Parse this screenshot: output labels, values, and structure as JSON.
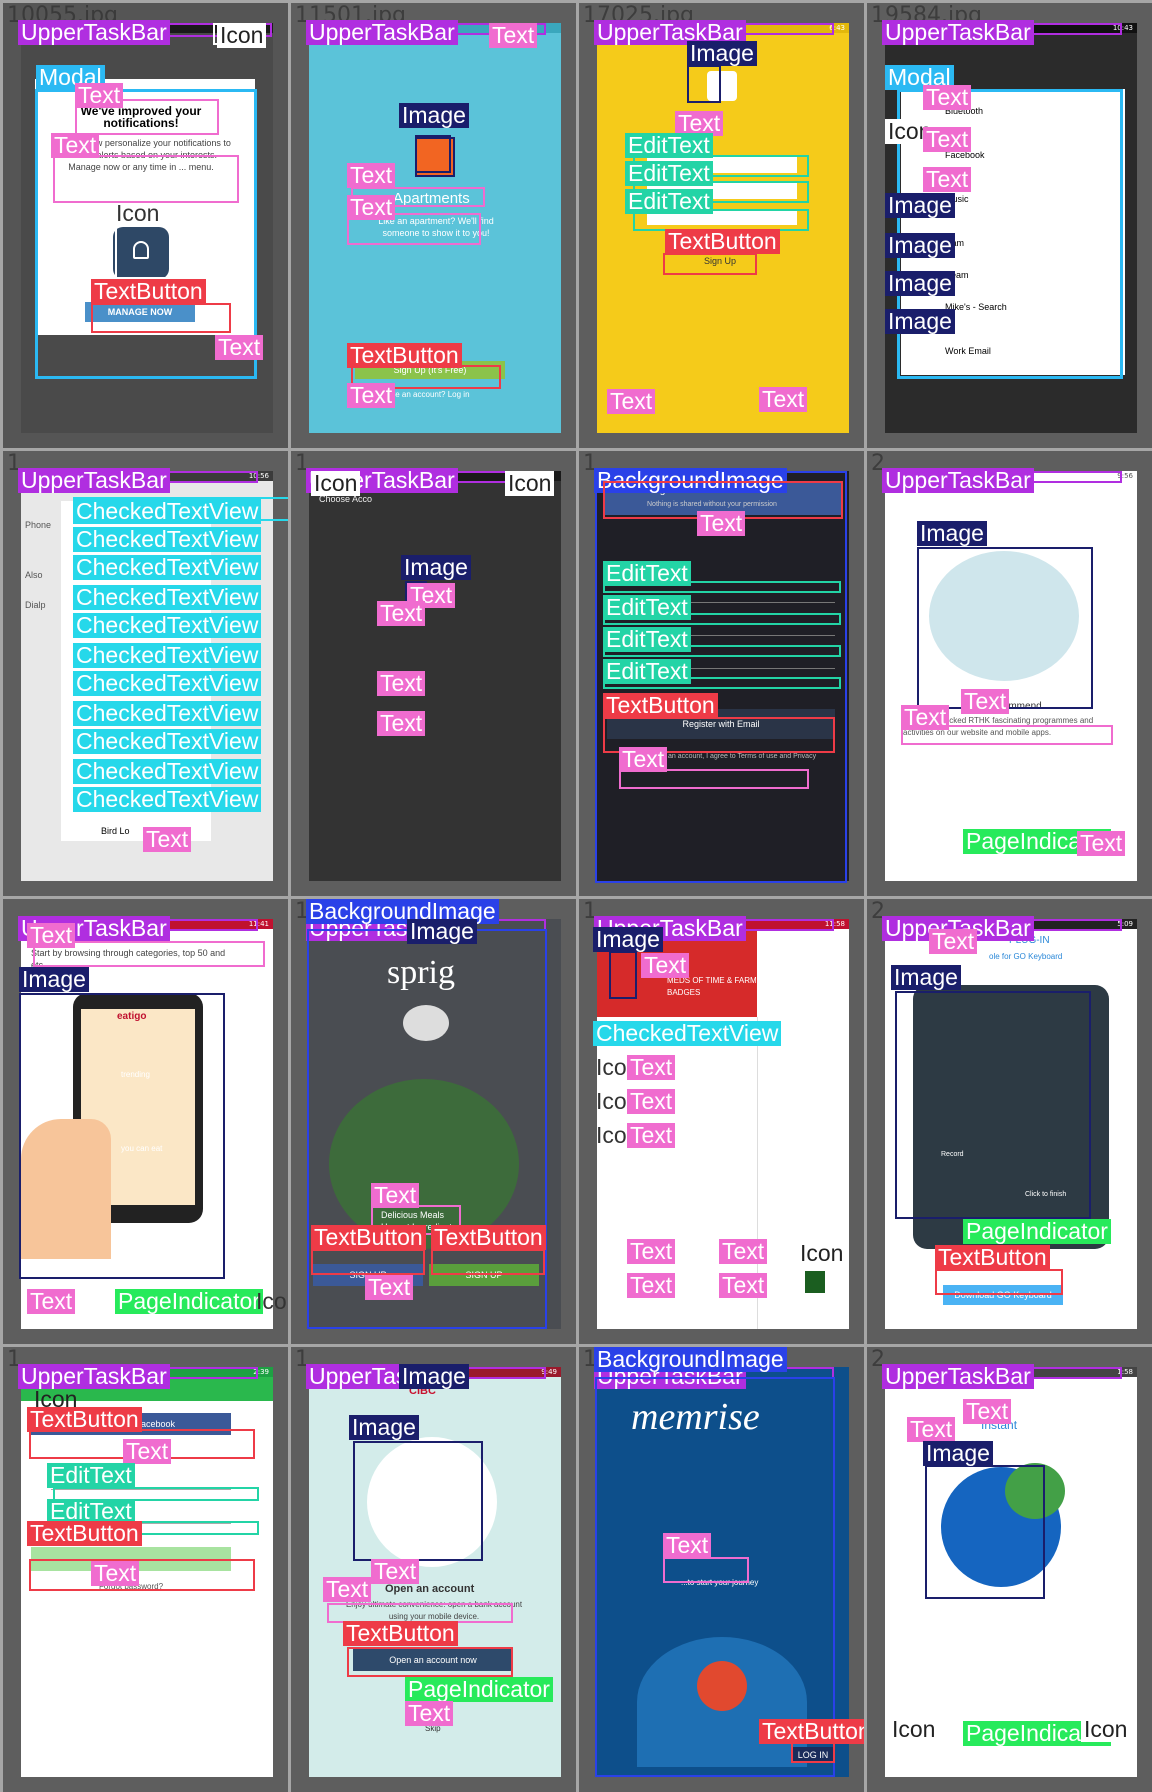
{
  "labels": {
    "upper": "UpperTaskBar",
    "text": "Text",
    "image": "Image",
    "icon": "Icon",
    "textbutton": "TextButton",
    "edittext": "EditText",
    "modal": "Modal",
    "checked": "CheckedTextView",
    "background": "BackgroundImage",
    "pageind": "PageIndicator"
  },
  "tiles": [
    {
      "id": "10055.jpg",
      "status": "",
      "modal_title": "We've improved your notifications!",
      "modal_body": "You can now personalize your notifications to receive alerts based on your interests. Manage now or any time in ... menu.",
      "button": "MANAGE NOW"
    },
    {
      "id": "11501.jpg",
      "status": "",
      "title": "Apartments",
      "body": "Like an apartment? We'll find someone to show it to you!",
      "button": "Sign Up (It's Free)",
      "footer": "Already have an account? Log in"
    },
    {
      "id": "17025.jpg",
      "status": "6:43",
      "button": "Sign Up"
    },
    {
      "id": "19584.jpg",
      "status": "10:43",
      "items": [
        "Bluetooth",
        "Facebook",
        "Music",
        "Cam",
        "Beam",
        "Mike's - Search",
        "Work Email"
      ]
    },
    {
      "id": "1",
      "status": "10:56",
      "rows": [
        "Phone",
        "Also",
        "Dialp"
      ],
      "footer": "Bird Lo"
    },
    {
      "id": "1",
      "status": "",
      "header": "Choose Acco"
    },
    {
      "id": "1",
      "status": "",
      "facebook": "Register with Facebook",
      "facebook_sub": "Nothing is shared without your permission",
      "email_button": "Register with Email",
      "terms": "By creating an account, I agree to Terms of use and Privacy Policy"
    },
    {
      "id": "2",
      "status": "9:56",
      "recommend": "Recommend",
      "body": "Enjoy handpicked RTHK fascinating programmes and activities on our website and mobile apps."
    },
    {
      "id": "",
      "status": "11:41",
      "body": "Start by browsing through categories, top 50 and etc...",
      "brand": "eatigo",
      "trending": "trending",
      "eat": "you can eat"
    },
    {
      "id": "1",
      "status": "",
      "brand": "sprig",
      "tagline": "Delicious Meals Honest Ingredients",
      "signup1": "SIGN UP",
      "signup2": "SIGN UP"
    },
    {
      "id": "1",
      "status": "11:58",
      "header": "MEDS OF TIME & FARM BADGES"
    },
    {
      "id": "2",
      "status": "5:09",
      "title": "PLUG-IN",
      "subtitle": "ole for GO Keyboard",
      "button": "Download GO Keyboard",
      "record": "Record",
      "finish": "Click to finish"
    },
    {
      "id": "1",
      "status": "2:39",
      "facebook": "Sign in with Facebook",
      "forgot": "Forgot password?"
    },
    {
      "id": "1",
      "status": "9:49",
      "brand": "CIBC",
      "title": "Open an account",
      "body": "Enjoy ultimate convenience: open a bank account using your mobile device.",
      "button": "Open an account now",
      "skip": "Skip"
    },
    {
      "id": "1",
      "status": "",
      "brand": "memrise",
      "body": "...to start your journey",
      "button": "LOG IN"
    },
    {
      "id": "2",
      "status": "1:58",
      "title": "Instant",
      "body": "..."
    }
  ]
}
